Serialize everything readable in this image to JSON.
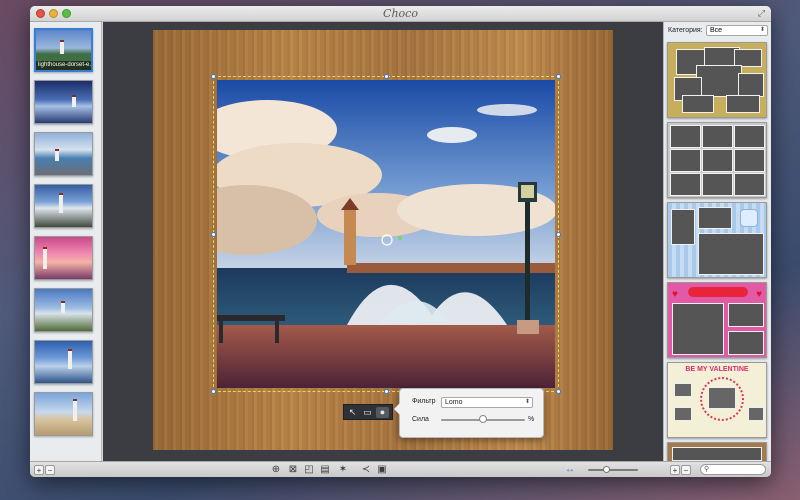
{
  "window": {
    "title": "Choco"
  },
  "photos": [
    {
      "caption": "lighthouse-dorset-e...",
      "selected": true
    },
    {
      "caption": ""
    },
    {
      "caption": ""
    },
    {
      "caption": ""
    },
    {
      "caption": ""
    },
    {
      "caption": ""
    },
    {
      "caption": ""
    },
    {
      "caption": ""
    }
  ],
  "filter_popup": {
    "filter_label": "Фильтр",
    "filter_value": "Lomo",
    "strength_label": "Сила",
    "strength_unit": "%",
    "strength_fraction": 0.5
  },
  "category": {
    "label": "Категория:",
    "value": "Все"
  },
  "templates": [
    {
      "name": "scrapbook-template"
    },
    {
      "name": "grid-template"
    },
    {
      "name": "baby-template"
    },
    {
      "name": "hearts-template"
    },
    {
      "name": "valentine-template",
      "text": "BE MY VALENTINE"
    }
  ],
  "bottombar": {
    "add_label": "+",
    "remove_label": "−",
    "zoom_fraction": 0.35
  },
  "colors": {
    "accent": "#3a7bd5",
    "canvas_bg": "#3b3d42",
    "selection": "#e8d85a"
  },
  "icons": {
    "tools": [
      "pointer-icon",
      "crop-icon",
      "filter-drop-icon"
    ],
    "bottom": [
      "add-circle-icon",
      "rotate-icon",
      "frame-icon",
      "layout-icon",
      "magic-wand-icon",
      "share-icon",
      "image-icon"
    ]
  }
}
